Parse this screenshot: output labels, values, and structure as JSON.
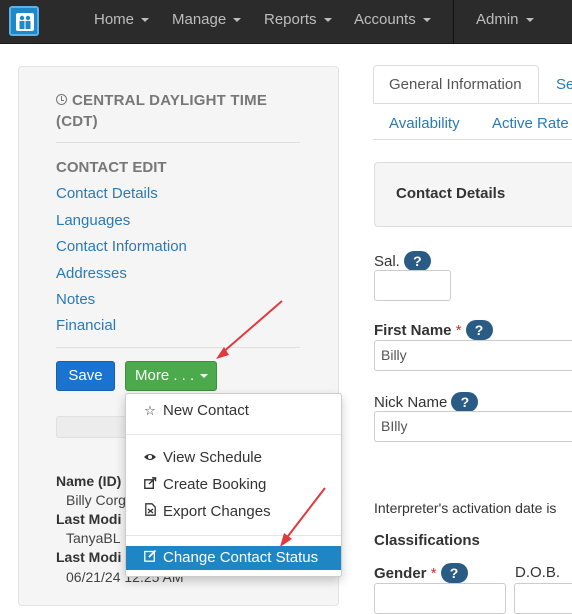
{
  "navbar": {
    "logo_icon": "people-logo-icon",
    "items": [
      {
        "label": "Home"
      },
      {
        "label": "Manage"
      },
      {
        "label": "Reports"
      },
      {
        "label": "Accounts"
      },
      {
        "label": "Admin"
      }
    ]
  },
  "sidebar": {
    "timezone": "CENTRAL DAYLIGHT TIME (CDT)",
    "section_title": "CONTACT EDIT",
    "links": [
      {
        "label": "Contact Details"
      },
      {
        "label": "Languages"
      },
      {
        "label": "Contact Information"
      },
      {
        "label": "Addresses"
      },
      {
        "label": "Notes"
      },
      {
        "label": "Financial"
      }
    ],
    "save_label": "Save",
    "more_label": "More . . .",
    "info": {
      "name_label": "Name (ID)",
      "name_value": "Billy Corg",
      "modified_label_1": "Last Modi",
      "modified_value_1": "TanyaBL",
      "modified_label_2": "Last Modi",
      "modified_value_2": "06/21/24 12:25 AM"
    }
  },
  "more_menu": {
    "items": [
      {
        "label": "New Contact",
        "icon": "star-outline-icon"
      },
      {
        "label": "View Schedule",
        "icon": "eye-icon"
      },
      {
        "label": "Create Booking",
        "icon": "share-icon"
      },
      {
        "label": "Export Changes",
        "icon": "file-export-icon"
      },
      {
        "label": "Change Contact Status",
        "icon": "edit-icon"
      }
    ],
    "active_color": "#1f86c6"
  },
  "tabs": {
    "active": "General Information",
    "others": [
      "Se",
      "Availability",
      "Active Rate"
    ]
  },
  "form": {
    "panel_title": "Contact Details",
    "sal_label": "Sal.",
    "help_text": "?",
    "first_name_label": "First Name",
    "first_name_value": "Billy",
    "nick_name_label": "Nick Name",
    "nick_name_value": "BIlly",
    "activation_note": "Interpreter's activation date is",
    "classifications_label": "Classifications",
    "gender_label": "Gender",
    "dob_label": "D.O.B.",
    "required_marker": "*"
  },
  "colors": {
    "navbar_bg": "#2b2b2b",
    "link": "#2a7ab8",
    "save_button": "#1a73d0",
    "more_button": "#4caa4c",
    "help_badge": "#2a5b85",
    "annotation_arrow": "#e0393e"
  }
}
